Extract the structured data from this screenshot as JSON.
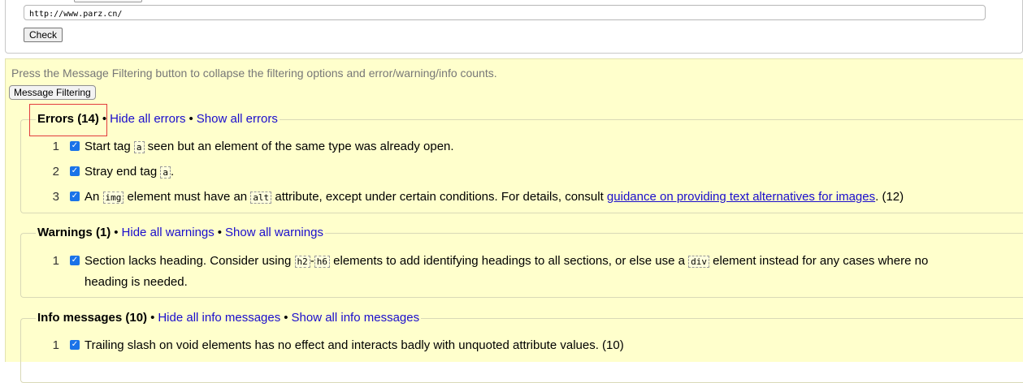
{
  "form": {
    "url_value": "http://www.parz.cn/",
    "check_label": "Check"
  },
  "results": {
    "instructions": "Press the Message Filtering button to collapse the filtering options and error/warning/info counts.",
    "filter_button": "Message Filtering",
    "errors": {
      "title": "Errors (14)",
      "hide_link": "Hide all errors",
      "show_link": "Show all errors",
      "separator": "•",
      "items": [
        {
          "num": "1",
          "pre": "Start tag ",
          "code": "a",
          "post": " seen but an element of the same type was already open."
        },
        {
          "num": "2",
          "pre": "Stray end tag ",
          "code": "a",
          "post": "."
        },
        {
          "num": "3",
          "pre": "An ",
          "code": "img",
          "mid1": " element must have an ",
          "code2": "alt",
          "mid2": " attribute, except under certain conditions. For details, consult ",
          "link": "guidance on providing text alternatives for images",
          "post": ". (12)"
        }
      ]
    },
    "warnings": {
      "title": "Warnings (1)",
      "hide_link": "Hide all warnings",
      "show_link": "Show all warnings",
      "separator": "•",
      "items": [
        {
          "num": "1",
          "pre": "Section lacks heading. Consider using ",
          "code": "h2",
          "dash": "-",
          "code2": "h6",
          "post": " elements to add identifying headings to all sections, or else use a ",
          "code3": "div",
          "post2": " element instead for any cases where no",
          "line2": "heading is needed."
        }
      ]
    },
    "info": {
      "title": "Info messages (10)",
      "hide_link": "Hide all info messages",
      "show_link": "Show all info messages",
      "separator": "•",
      "items": [
        {
          "num": "1",
          "pre": "Trailing slash on void elements has no effect and interacts badly with unquoted attribute values. (10)"
        }
      ]
    }
  },
  "icons": {
    "checkbox": "checkbox-checked-icon"
  },
  "colors": {
    "panel_bg": "#ffffcc",
    "link": "#1a0dcc",
    "highlight": "#e23c3c",
    "checkbox": "#1a73e8"
  }
}
